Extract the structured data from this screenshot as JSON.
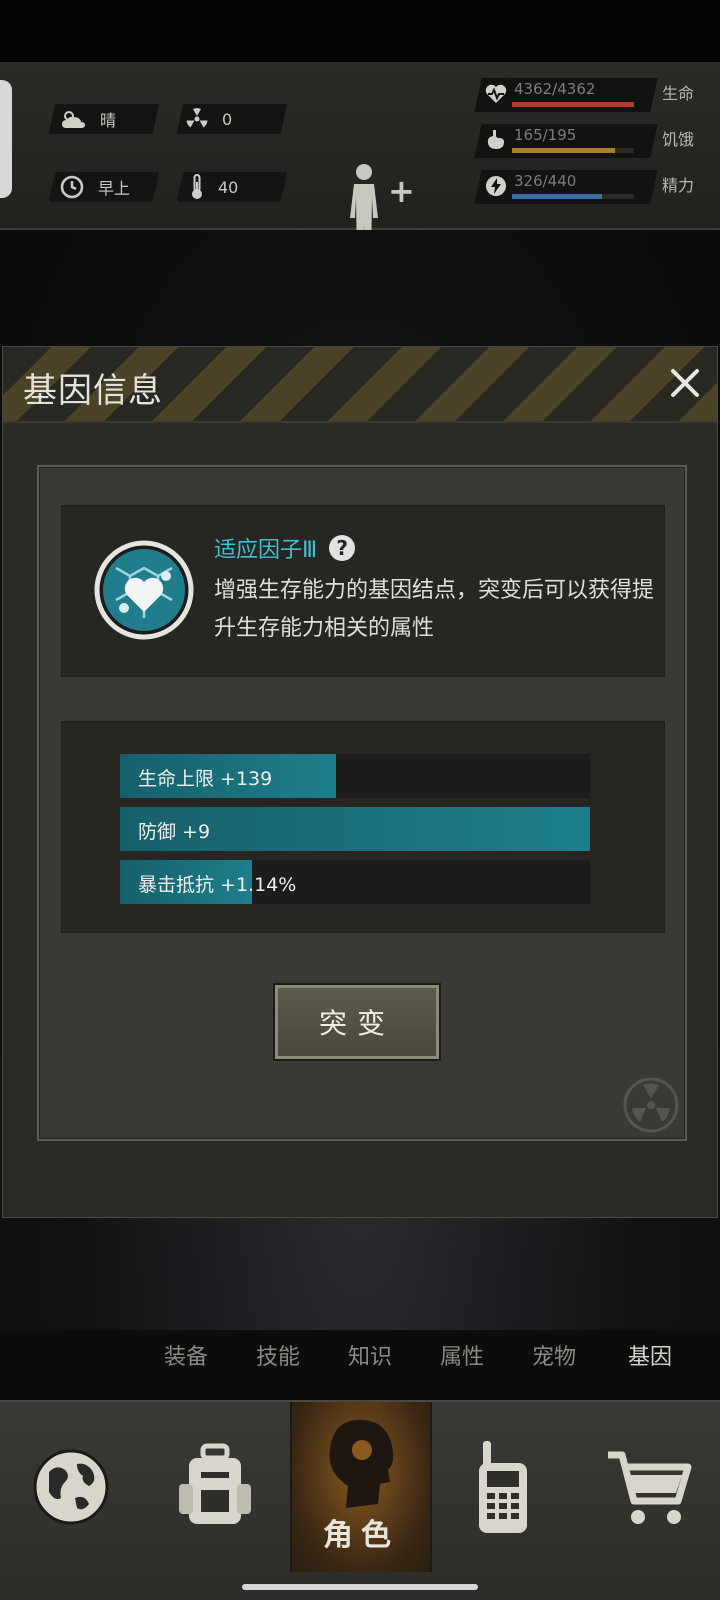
{
  "status": {
    "weather": {
      "label": "晴",
      "icon": "cloud-sun-icon"
    },
    "radiation": {
      "value": "0",
      "icon": "radiation-icon"
    },
    "time_of_day": {
      "label": "早上",
      "icon": "clock-icon"
    },
    "temperature": {
      "value": "40",
      "icon": "thermometer-icon"
    },
    "stats": [
      {
        "name": "生命",
        "value": "4362/4362",
        "fraction": 1.0,
        "color": "#b63a30",
        "icon": "heart-pulse-icon"
      },
      {
        "name": "饥饿",
        "value": "165/195",
        "fraction": 0.846,
        "color": "#a8822e",
        "icon": "stomach-icon"
      },
      {
        "name": "精力",
        "value": "326/440",
        "fraction": 0.741,
        "color": "#3c6ea8",
        "icon": "energy-icon"
      }
    ]
  },
  "modal": {
    "title": "基因信息",
    "gene": {
      "name": "适应因子Ⅲ",
      "description": "增强生存能力的基因结点，突变后可以获得提升生存能力相关的属性"
    },
    "attributes": [
      {
        "label": "生命上限 +139",
        "fraction": 0.46
      },
      {
        "label": "防御 +9",
        "fraction": 1.0
      },
      {
        "label": "暴击抵抗 +1.14%",
        "fraction": 0.28
      }
    ],
    "mutate_label": "突变"
  },
  "tabs": [
    {
      "label": "装备",
      "active": false
    },
    {
      "label": "技能",
      "active": false
    },
    {
      "label": "知识",
      "active": false
    },
    {
      "label": "属性",
      "active": false
    },
    {
      "label": "宠物",
      "active": false
    },
    {
      "label": "基因",
      "active": true
    }
  ],
  "bottom_nav": {
    "active_label": "角色",
    "items": [
      "globe-icon",
      "backpack-icon",
      "head-icon",
      "walkie-talkie-icon",
      "cart-icon"
    ]
  },
  "colors": {
    "accent_teal": "#1e7f8c",
    "gene_name": "#3ec2d0"
  }
}
